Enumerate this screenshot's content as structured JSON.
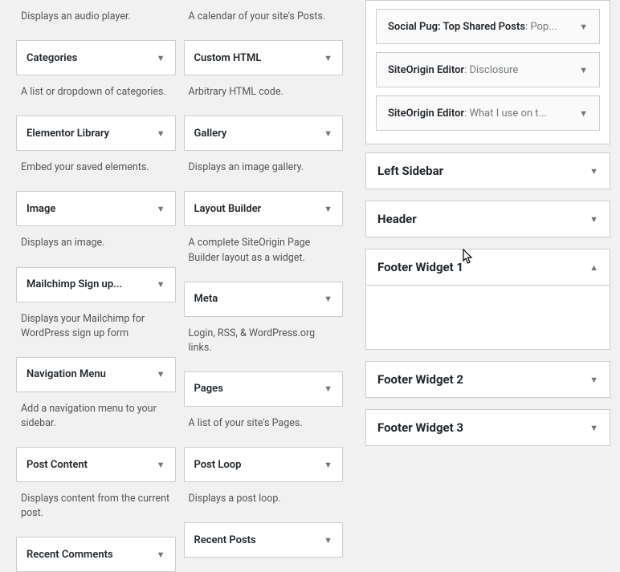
{
  "available_widgets": {
    "col1": [
      {
        "desc_above": "Displays an audio player.",
        "title": "Categories",
        "desc": "A list or dropdown of categories."
      },
      {
        "title": "Elementor Library",
        "desc": "Embed your saved elements."
      },
      {
        "title": "Image",
        "desc": "Displays an image."
      },
      {
        "title": "Mailchimp Sign up...",
        "desc": "Displays your Mailchimp for WordPress sign up form"
      },
      {
        "title": "Navigation Menu",
        "desc": "Add a navigation menu to your sidebar."
      },
      {
        "title": "Post Content",
        "desc": "Displays content from the current post."
      },
      {
        "title": "Recent Comments",
        "desc": ""
      }
    ],
    "col2": [
      {
        "desc_above": "A calendar of your site's Posts.",
        "title": "Custom HTML",
        "desc": "Arbitrary HTML code."
      },
      {
        "title": "Gallery",
        "desc": "Displays an image gallery."
      },
      {
        "title": "Layout Builder",
        "desc": "A complete SiteOrigin Page Builder layout as a widget."
      },
      {
        "title": "Meta",
        "desc": "Login, RSS, & WordPress.org links."
      },
      {
        "title": "Pages",
        "desc": "A list of your site's Pages."
      },
      {
        "title": "Post Loop",
        "desc": "Displays a post loop."
      },
      {
        "title": "Recent Posts",
        "desc": ""
      }
    ]
  },
  "sidebar_areas": {
    "top_widgets": [
      {
        "type": "Social Pug: Top Shared Posts",
        "instance": "Pop..."
      },
      {
        "type": "SiteOrigin Editor",
        "instance": "Disclosure"
      },
      {
        "type": "SiteOrigin Editor",
        "instance": "What I use on t..."
      }
    ],
    "areas": [
      {
        "title": "Left Sidebar",
        "expanded": false
      },
      {
        "title": "Header",
        "expanded": false
      },
      {
        "title": "Footer Widget 1",
        "expanded": true
      },
      {
        "title": "Footer Widget 2",
        "expanded": false
      },
      {
        "title": "Footer Widget 3",
        "expanded": false
      }
    ]
  }
}
